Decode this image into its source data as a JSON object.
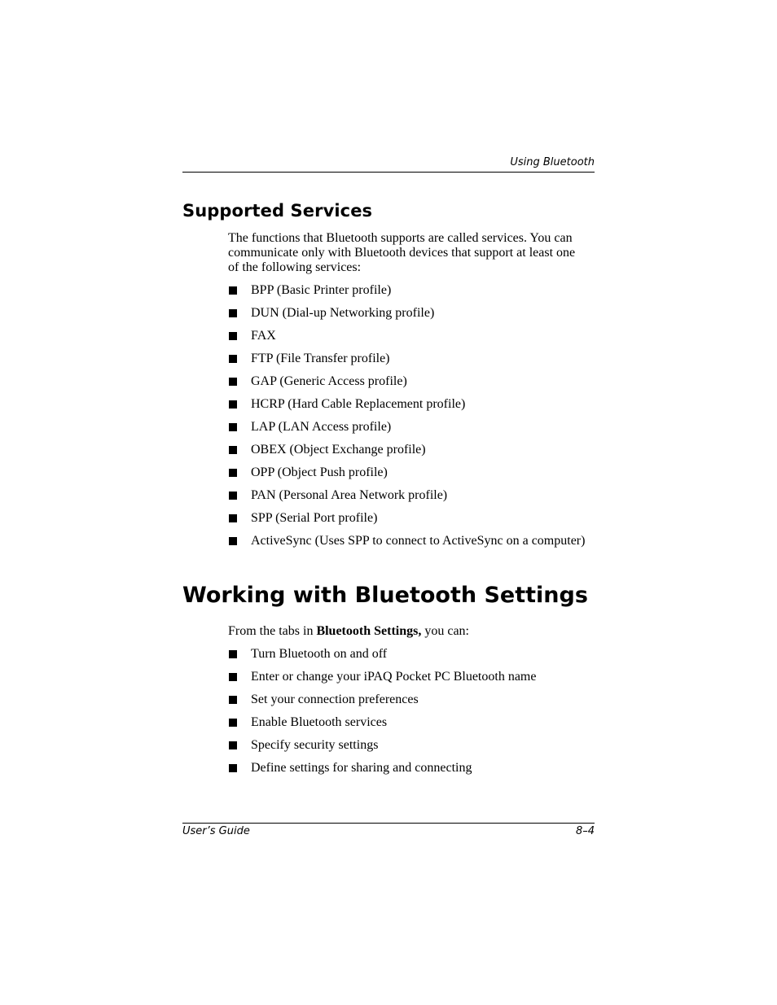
{
  "header": {
    "running_head": "Using Bluetooth"
  },
  "section1": {
    "title": "Supported Services",
    "intro": "The functions that Bluetooth supports are called services. You can communicate only with Bluetooth devices that support at least one of the following services:",
    "items": [
      "BPP (Basic Printer profile)",
      "DUN (Dial-up Networking profile)",
      "FAX",
      "FTP (File Transfer profile)",
      "GAP (Generic Access profile)",
      "HCRP (Hard Cable Replacement profile)",
      "LAP (LAN Access profile)",
      "OBEX (Object Exchange profile)",
      "OPP (Object Push profile)",
      "PAN (Personal Area Network profile)",
      "SPP (Serial Port profile)",
      "ActiveSync (Uses SPP to connect to ActiveSync on a computer)"
    ]
  },
  "section2": {
    "title": "Working with Bluetooth Settings",
    "intro_prefix": "From the tabs in ",
    "intro_bold": "Bluetooth Settings,",
    "intro_suffix": " you can:",
    "items": [
      "Turn Bluetooth on and off",
      "Enter or change your iPAQ Pocket PC Bluetooth name",
      "Set your connection preferences",
      "Enable Bluetooth services",
      "Specify security settings",
      "Define settings for sharing and connecting"
    ]
  },
  "footer": {
    "left": "User’s Guide",
    "right": "8–4"
  }
}
